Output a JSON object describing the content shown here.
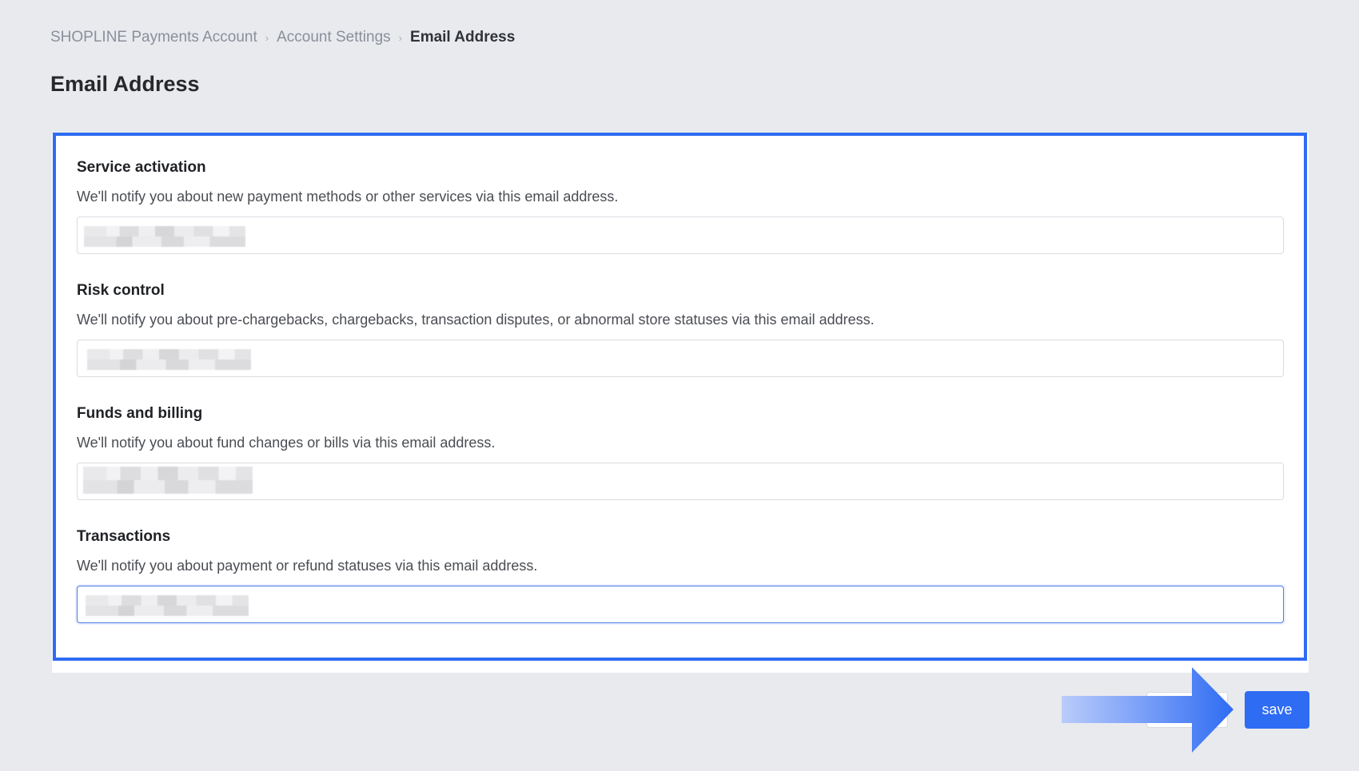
{
  "breadcrumb": {
    "items": [
      "SHOPLINE Payments Account",
      "Account Settings"
    ],
    "current": "Email Address",
    "separator": "›"
  },
  "page": {
    "title": "Email Address"
  },
  "sections": [
    {
      "title": "Service activation",
      "description": "We'll notify you about new payment methods or other services via this email address.",
      "value": "(redacted)",
      "placeholder": ""
    },
    {
      "title": "Risk control",
      "description": "We'll notify you about pre-chargebacks, chargebacks, transaction disputes, or abnormal store statuses via this email address.",
      "value": "(redacted)",
      "placeholder": ""
    },
    {
      "title": "Funds and billing",
      "description": "We'll notify you about fund changes or bills via this email address.",
      "value": "(redacted)",
      "placeholder": ""
    },
    {
      "title": "Transactions",
      "description": "We'll notify you about payment or refund statuses via this email address.",
      "value": "(redacted)",
      "placeholder": ""
    }
  ],
  "actions": {
    "save_label": "save",
    "cancel_label": ""
  },
  "colors": {
    "accent": "#2e6cf3",
    "background": "#e9eaee",
    "card": "#ffffff"
  },
  "icons": {
    "breadcrumb_separator": "chevron-right-icon",
    "annotation_arrow": "arrow-right-icon"
  }
}
